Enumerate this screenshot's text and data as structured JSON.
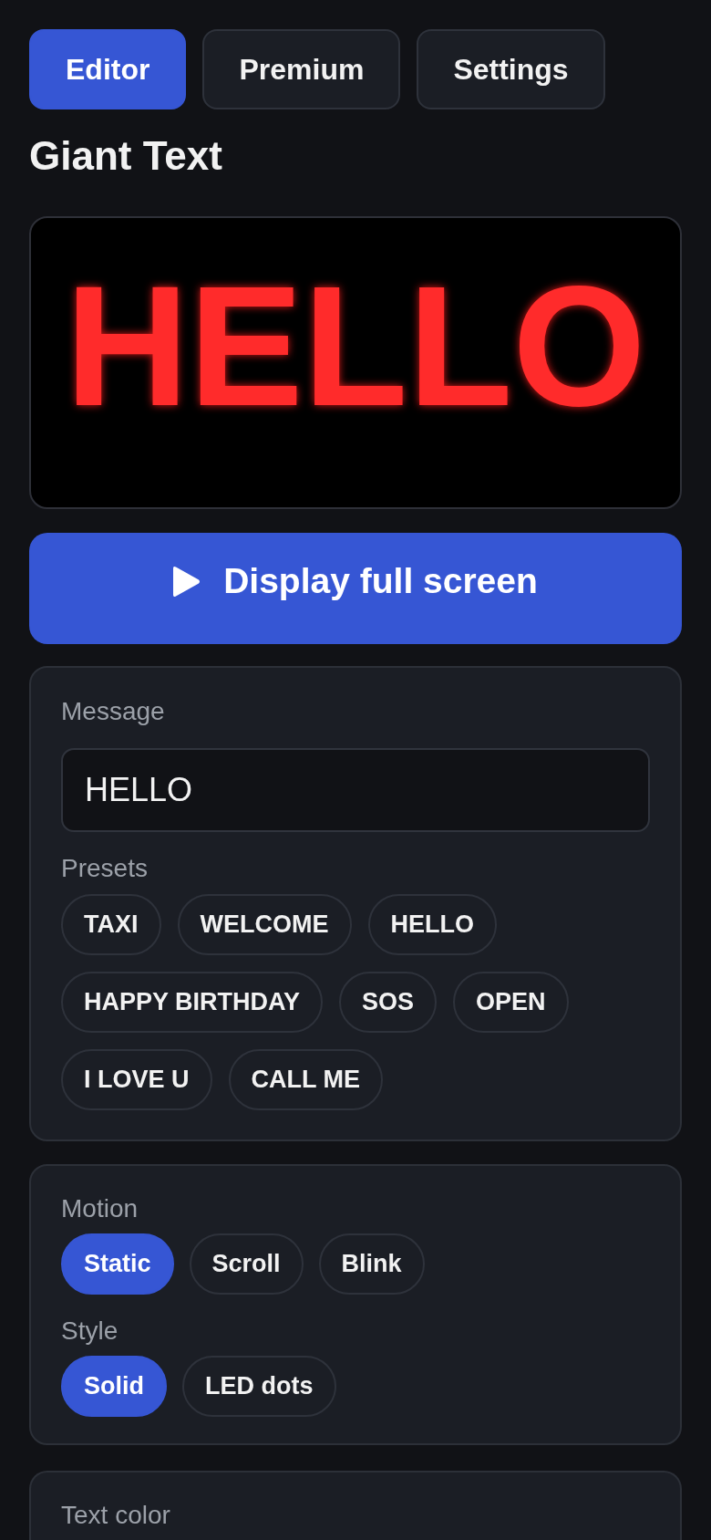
{
  "tabs": [
    {
      "label": "Editor",
      "selected": true
    },
    {
      "label": "Premium",
      "selected": false
    },
    {
      "label": "Settings",
      "selected": false
    }
  ],
  "title": "Giant Text",
  "preview": {
    "text": "HELLO"
  },
  "display_button": {
    "label": "Display full screen"
  },
  "message": {
    "label": "Message",
    "value": "HELLO"
  },
  "presets": {
    "label": "Presets",
    "items": [
      "TAXI",
      "WELCOME",
      "HELLO",
      "HAPPY BIRTHDAY",
      "SOS",
      "OPEN",
      "I LOVE U",
      "CALL ME"
    ]
  },
  "motion": {
    "label": "Motion",
    "options": [
      {
        "label": "Static",
        "selected": true
      },
      {
        "label": "Scroll",
        "selected": false
      },
      {
        "label": "Blink",
        "selected": false
      }
    ]
  },
  "style": {
    "label": "Style",
    "options": [
      {
        "label": "Solid",
        "selected": true
      },
      {
        "label": "LED dots",
        "selected": false
      }
    ]
  },
  "text_color": {
    "label": "Text color"
  }
}
